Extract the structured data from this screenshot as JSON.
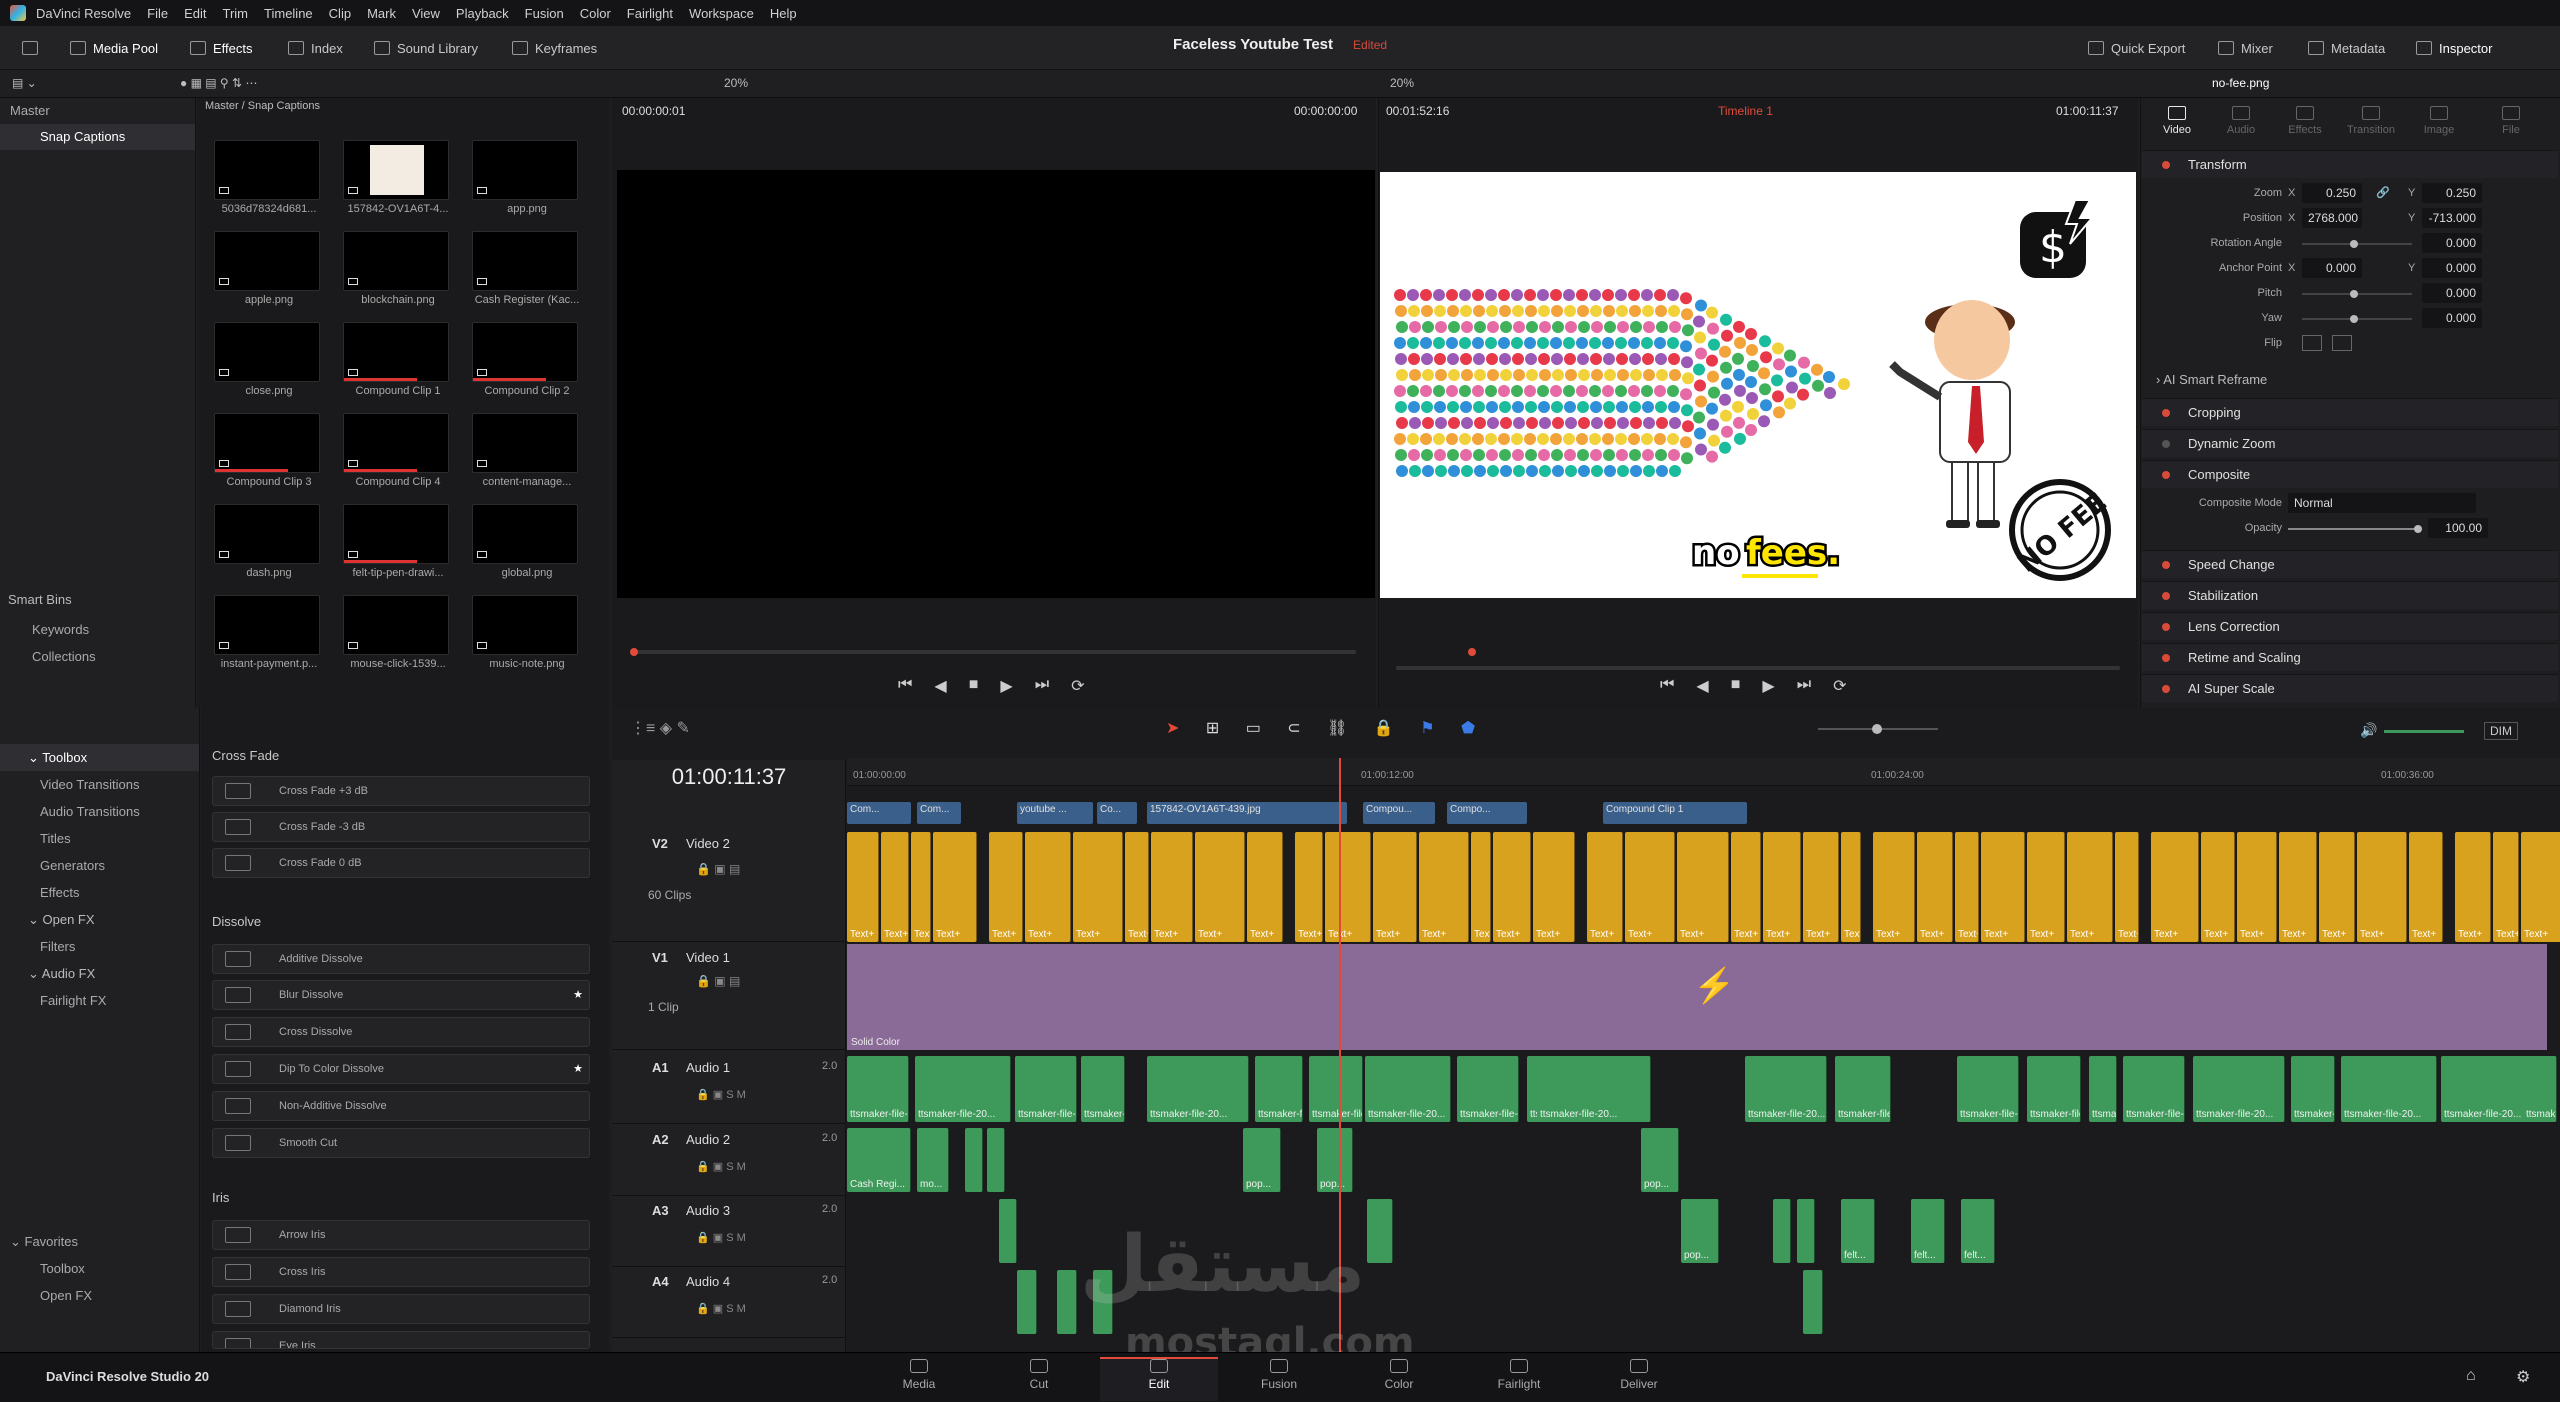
{
  "menu": [
    "DaVinci Resolve",
    "File",
    "Edit",
    "Trim",
    "Timeline",
    "Clip",
    "Mark",
    "View",
    "Playback",
    "Fusion",
    "Color",
    "Fairlight",
    "Workspace",
    "Help"
  ],
  "toolbar": {
    "left": [
      "Media Pool",
      "Effects",
      "Index",
      "Sound Library",
      "Keyframes"
    ],
    "project_title": "Faceless Youtube Test",
    "project_status": "Edited",
    "right": [
      "Quick Export",
      "Mixer",
      "Metadata",
      "Inspector"
    ]
  },
  "subbar": {
    "src_zoom": "20%",
    "pgm_zoom": "20%",
    "inspector_clip": "no-fee.png"
  },
  "bins": {
    "master": "Master",
    "selected": "Snap Captions",
    "smart_bins": "Smart Bins",
    "smart_items": [
      "Keywords",
      "Collections"
    ],
    "breadcrumb": "Master / Snap Captions"
  },
  "media": [
    "5036d78324d681...",
    "157842-OV1A6T-4...",
    "app.png",
    "apple.png",
    "blockchain.png",
    "Cash Register (Kac...",
    "close.png",
    "Compound Clip 1",
    "Compound Clip 2",
    "Compound Clip 3",
    "Compound Clip 4",
    "content-manage...",
    "dash.png",
    "felt-tip-pen-drawi...",
    "global.png",
    "instant-payment.p...",
    "mouse-click-1539...",
    "music-note.png"
  ],
  "source_viewer": {
    "tc_left": "00:00:00:01",
    "tc_right": "00:00:00:00"
  },
  "program_viewer": {
    "tc_left": "00:01:52:16",
    "timeline_name": "Timeline 1",
    "tc_right": "01:00:11:37",
    "caption_a": "no",
    "caption_b": "fees.",
    "badge": "NO FEE"
  },
  "inspector": {
    "tabs": [
      "Video",
      "Audio",
      "Effects",
      "Transition",
      "Image",
      "File"
    ],
    "transform": "Transform",
    "fields": [
      {
        "label": "Zoom",
        "x": "0.250",
        "y": "0.250"
      },
      {
        "label": "Position",
        "x": "2768.000",
        "y": "-713.000"
      },
      {
        "label": "Rotation Angle",
        "v": "0.000"
      },
      {
        "label": "Anchor Point",
        "x": "0.000",
        "y": "0.000"
      },
      {
        "label": "Pitch",
        "v": "0.000"
      },
      {
        "label": "Yaw",
        "v": "0.000"
      },
      {
        "label": "Flip",
        "v": ""
      }
    ],
    "ai_reframe": "AI Smart Reframe",
    "sections": [
      "Cropping",
      "Dynamic Zoom",
      "Composite"
    ],
    "composite_mode_label": "Composite Mode",
    "composite_mode": "Normal",
    "opacity_label": "Opacity",
    "opacity": "100.00",
    "sections2": [
      "Speed Change",
      "Stabilization",
      "Lens Correction",
      "Retime and Scaling",
      "AI Super Scale"
    ]
  },
  "fxtree": {
    "toolbox": "Toolbox",
    "items": [
      "Video Transitions",
      "Audio Transitions",
      "Titles",
      "Generators",
      "Effects"
    ],
    "openfx": "Open FX",
    "openfx_items": [
      "Filters"
    ],
    "audiofx": "Audio FX",
    "audiofx_items": [
      "Fairlight FX"
    ],
    "favorites": "Favorites",
    "fav_items": [
      "Toolbox",
      "Open FX"
    ]
  },
  "fxlist": {
    "cross_fade": "Cross Fade",
    "cf_items": [
      "Cross Fade +3 dB",
      "Cross Fade -3 dB",
      "Cross Fade 0 dB"
    ],
    "dissolve": "Dissolve",
    "d_items": [
      "Additive Dissolve",
      "Blur Dissolve",
      "Cross Dissolve",
      "Dip To Color Dissolve",
      "Non-Additive Dissolve",
      "Smooth Cut"
    ],
    "iris": "Iris",
    "i_items": [
      "Arrow Iris",
      "Cross Iris",
      "Diamond Iris",
      "Eye Iris"
    ]
  },
  "timeline": {
    "timecode": "01:00:11:37",
    "ruler": [
      "01:00:00:00",
      "01:00:12:00",
      "01:00:24:00",
      "01:00:36:00"
    ],
    "dim": "DIM",
    "tracks": [
      {
        "id": "V2",
        "name": "Video 2",
        "info": "60 Clips"
      },
      {
        "id": "V1",
        "name": "Video 1",
        "info": "1 Clip"
      },
      {
        "id": "A1",
        "name": "Audio 1",
        "level": "2.0"
      },
      {
        "id": "A2",
        "name": "Audio 2",
        "level": "2.0"
      },
      {
        "id": "A3",
        "name": "Audio 3",
        "level": "2.0"
      },
      {
        "id": "A4",
        "name": "Audio 4",
        "level": "2.0"
      }
    ],
    "v3_clips": [
      "Com...",
      "Com...",
      "youtube ...",
      "Co...",
      "157842-OV1A6T-439.jpg",
      "Compou...",
      "Compo...",
      "Compound Clip 1"
    ],
    "solid": "Solid Color",
    "a1_clip": "ttsmaker-file-20...",
    "a2_clips": [
      "Cash Regi...",
      "mo...",
      "pop...",
      "pop...",
      "pop..."
    ],
    "a3_clips": [
      "pop...",
      "felt...",
      "felt...",
      "felt..."
    ],
    "text_label": "Text+"
  },
  "pages": [
    "Media",
    "Cut",
    "Edit",
    "Fusion",
    "Color",
    "Fairlight",
    "Deliver"
  ],
  "active_page": "Edit",
  "app_name": "DaVinci Resolve Studio 20",
  "watermark": "مستقل",
  "watermark_url": "mostaql.com"
}
